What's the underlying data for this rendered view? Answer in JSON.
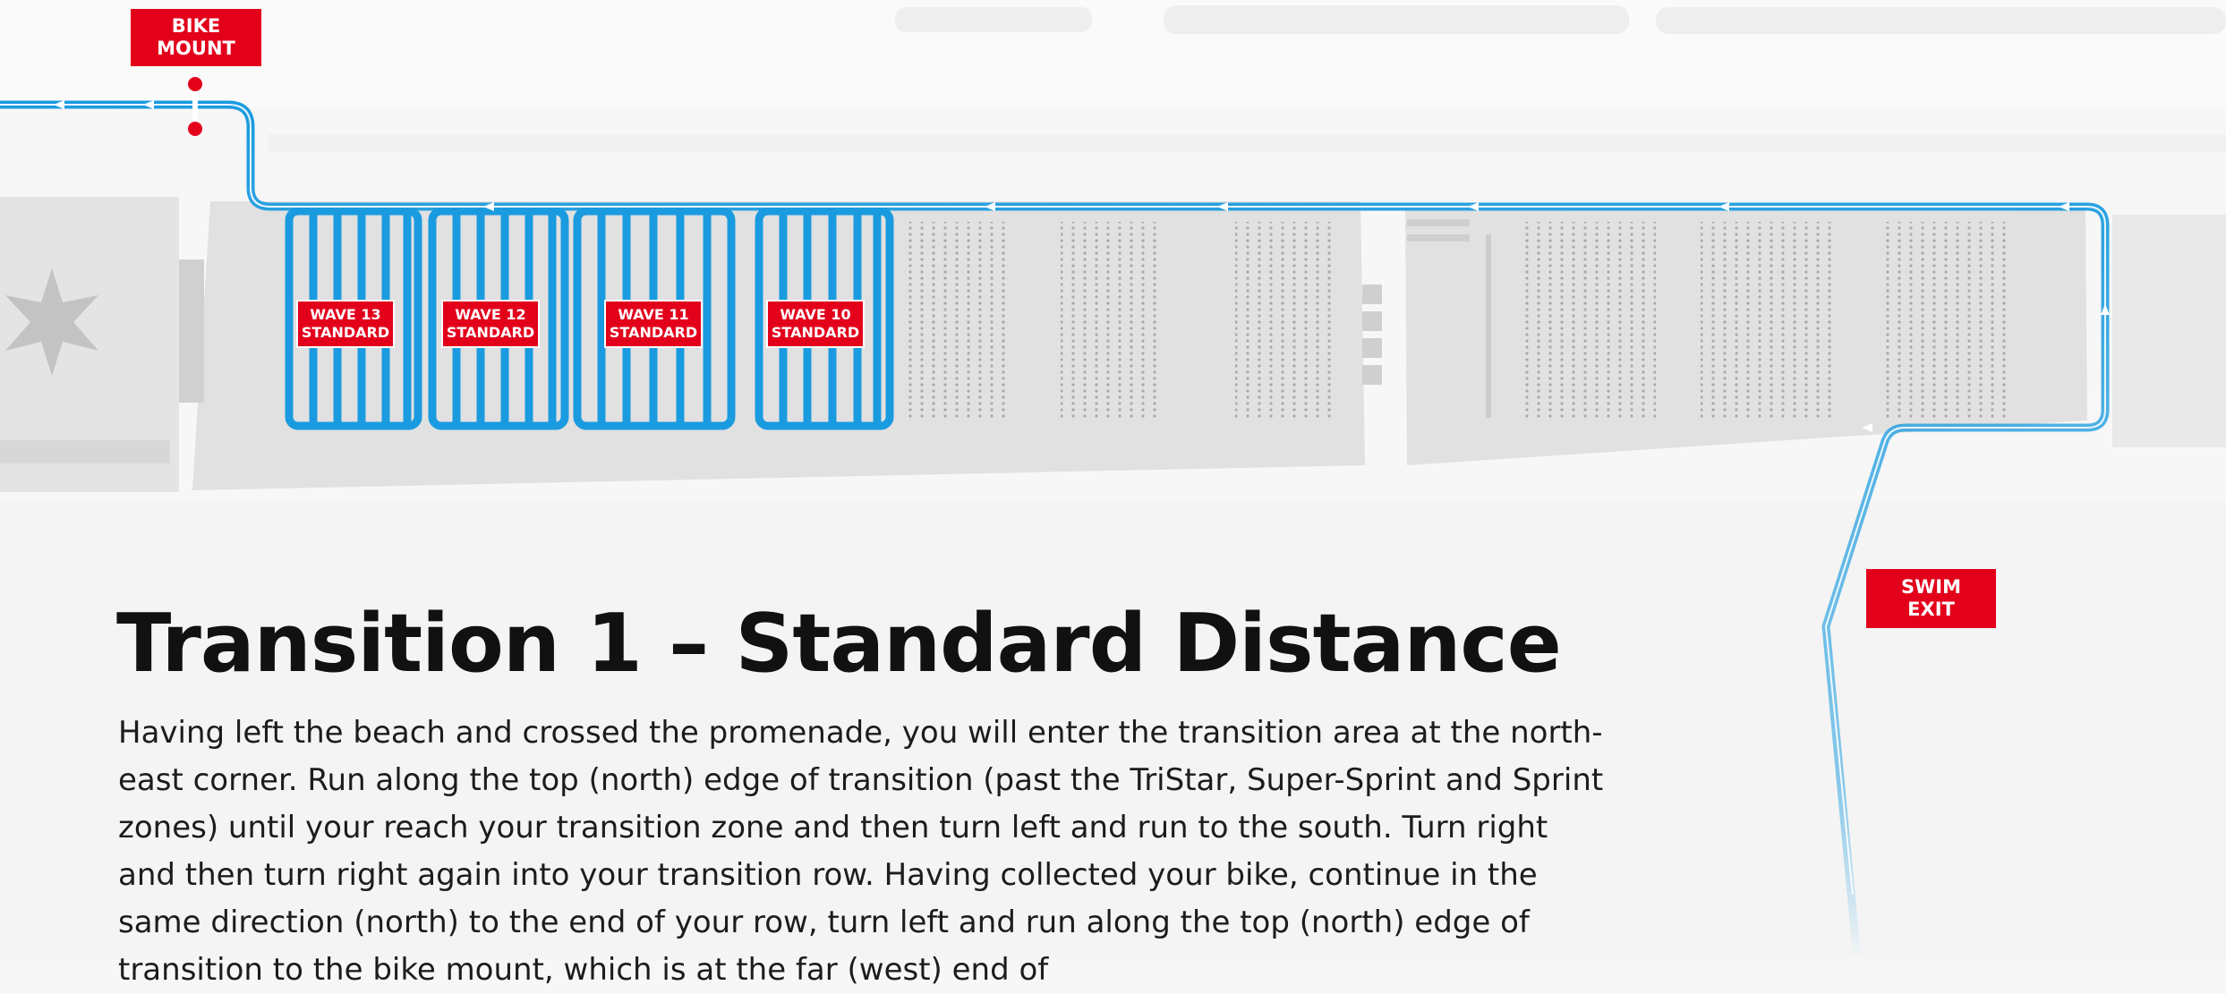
{
  "labels": {
    "bike_mount": [
      "BIKE",
      "MOUNT"
    ],
    "swim_exit": [
      "SWIM",
      "EXIT"
    ],
    "waves": [
      {
        "line1": "WAVE 13",
        "line2": "STANDARD"
      },
      {
        "line1": "WAVE 12",
        "line2": "STANDARD"
      },
      {
        "line1": "WAVE 11",
        "line2": "STANDARD"
      },
      {
        "line1": "WAVE 10",
        "line2": "STANDARD"
      }
    ]
  },
  "title": "Transition 1 – Standard Distance",
  "description": "Having left the beach and crossed the promenade, you will enter the transition area at the north-east corner. Run along the top (north) edge of transition (past the TriStar, Super-Sprint and Sprint zones) until your reach your transition zone and then turn left and run to the south. Turn right and then turn right again into your transition row. Having collected your bike, continue in the same direction (north) to the end of your row, turn left and run along the top (north) edge of transition to the bike mount, which is at the far (west) end of",
  "colors": {
    "route": "#1a9be0",
    "label_red": "#e3001b",
    "zone_grey": "#e1e1e1",
    "background": "#f7f7f7"
  }
}
